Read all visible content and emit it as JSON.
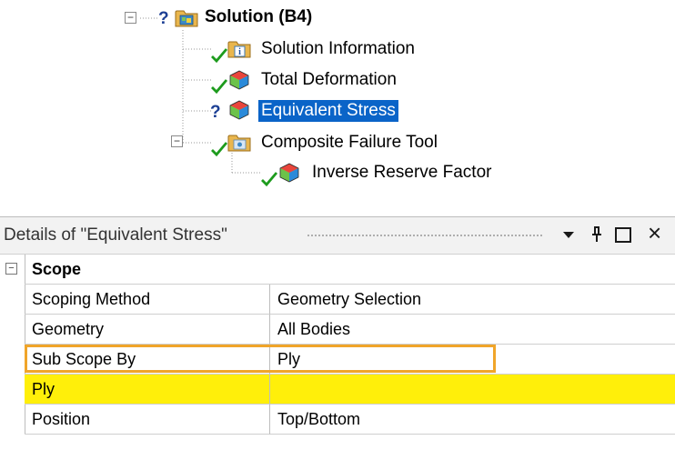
{
  "tree": {
    "nodes": [
      {
        "label": "Solution (B4)",
        "status": "question",
        "icon": "solution-folder-icon"
      },
      {
        "label": "Solution Information",
        "status": "check",
        "icon": "solution-information-icon"
      },
      {
        "label": "Total Deformation",
        "status": "check",
        "icon": "deformation-result-icon"
      },
      {
        "label": "Equivalent Stress",
        "status": "question",
        "icon": "stress-result-icon",
        "selected": true
      },
      {
        "label": "Composite Failure Tool",
        "status": "check",
        "icon": "composite-failure-folder-icon"
      },
      {
        "label": "Inverse Reserve Factor",
        "status": "check",
        "icon": "reserve-factor-result-icon"
      }
    ],
    "expander_symbol": "−",
    "question_symbol": "?"
  },
  "details": {
    "title": "Details of \"Equivalent Stress\"",
    "header_buttons": [
      "dropdown-arrow",
      "pin",
      "maximize",
      "close"
    ],
    "close_symbol": "×",
    "category": "Scope",
    "category_collapse_symbol": "−",
    "rows": [
      {
        "name": "Scoping Method",
        "value": "Geometry Selection"
      },
      {
        "name": "Geometry",
        "value": "All Bodies"
      },
      {
        "name": "Sub Scope By",
        "value": "Ply",
        "outlined": true
      },
      {
        "name": "Ply",
        "value": "",
        "highlight": "#ffef0a"
      },
      {
        "name": "Position",
        "value": "Top/Bottom"
      }
    ]
  },
  "colors": {
    "selection": "#0a64c8",
    "highlight_yellow": "#ffef0a",
    "outline_orange": "#f0a52a",
    "check_green": "#1d9b1d",
    "question_blue": "#1c3f94"
  }
}
